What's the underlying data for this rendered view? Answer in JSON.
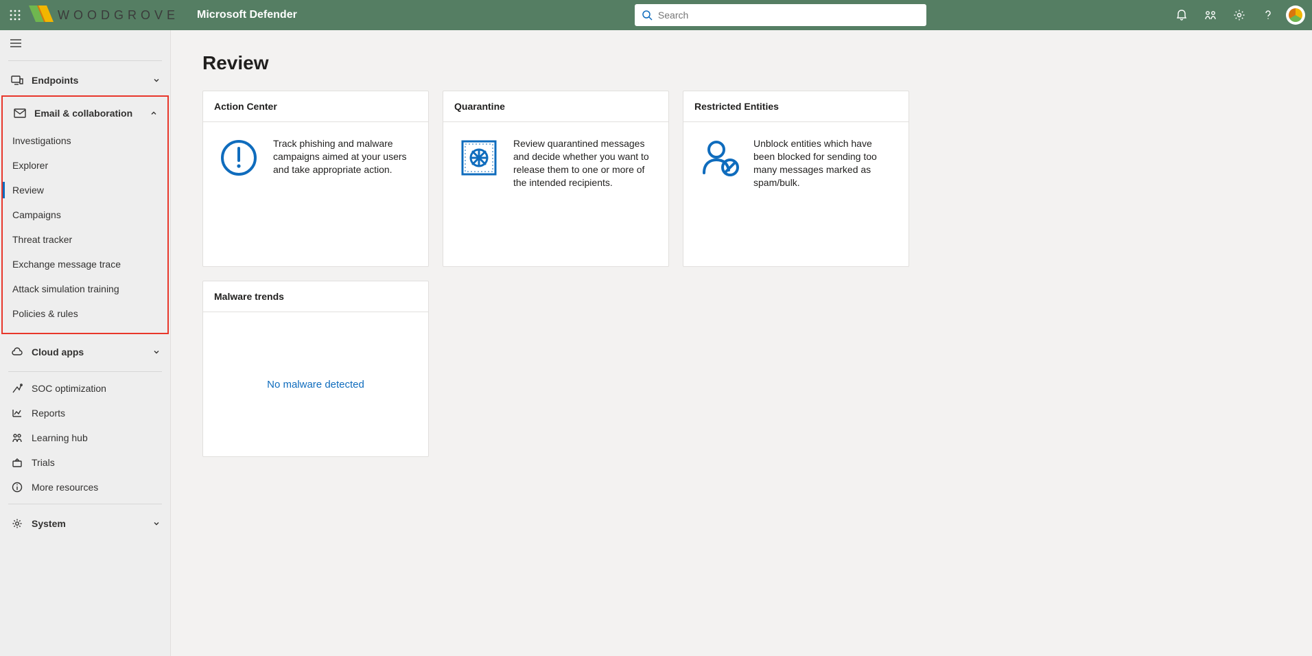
{
  "brand": {
    "org": "WOODGROVE",
    "app": "Microsoft Defender"
  },
  "search": {
    "placeholder": "Search"
  },
  "page": {
    "title": "Review"
  },
  "sidebar": {
    "endpoints": "Endpoints",
    "email": "Email & collaboration",
    "email_items": {
      "investigations": "Investigations",
      "explorer": "Explorer",
      "review": "Review",
      "campaigns": "Campaigns",
      "threat_tracker": "Threat tracker",
      "exchange_trace": "Exchange message trace",
      "attack_sim": "Attack simulation training",
      "policies": "Policies & rules"
    },
    "cloud_apps": "Cloud apps",
    "soc": "SOC optimization",
    "reports": "Reports",
    "learning": "Learning hub",
    "trials": "Trials",
    "more": "More resources",
    "system": "System"
  },
  "cards": {
    "action_center": {
      "title": "Action Center",
      "desc": "Track phishing and malware campaigns aimed at your users and take appropriate action."
    },
    "quarantine": {
      "title": "Quarantine",
      "desc": "Review quarantined messages and decide whether you want to release them to one or more of the intended recipients."
    },
    "restricted": {
      "title": "Restricted Entities",
      "desc": "Unblock entities which have been blocked for sending too many messages marked as spam/bulk."
    },
    "malware": {
      "title": "Malware trends",
      "msg": "No malware detected"
    }
  }
}
